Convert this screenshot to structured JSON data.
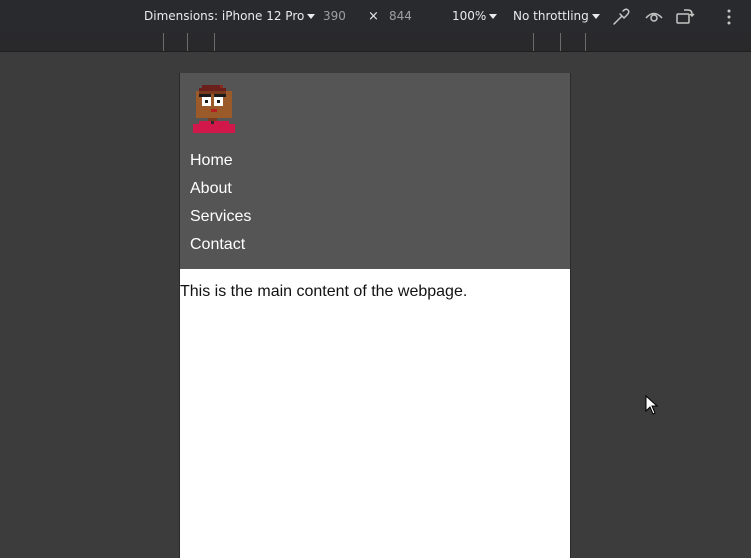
{
  "devtools_toolbar": {
    "dimensions_label": "Dimensions: iPhone 12 Pro",
    "width_value": "390",
    "separator": "×",
    "height_value": "844",
    "zoom": "100%",
    "throttling": "No throttling",
    "icons": [
      "eyedropper-icon",
      "eye-icon",
      "rotate-device-icon",
      "more-options-icon"
    ]
  },
  "page": {
    "nav": {
      "items": [
        {
          "label": "Home"
        },
        {
          "label": "About"
        },
        {
          "label": "Services"
        },
        {
          "label": "Contact"
        }
      ]
    },
    "main": {
      "text": "This is the main content of the webpage."
    }
  },
  "colors": {
    "header_bg": "#555555",
    "toolbar_bg": "#292a2d",
    "canvas_bg": "#3c3c3c",
    "avatar_shirt": "#d2184a",
    "avatar_skin": "#9a5a2a"
  }
}
